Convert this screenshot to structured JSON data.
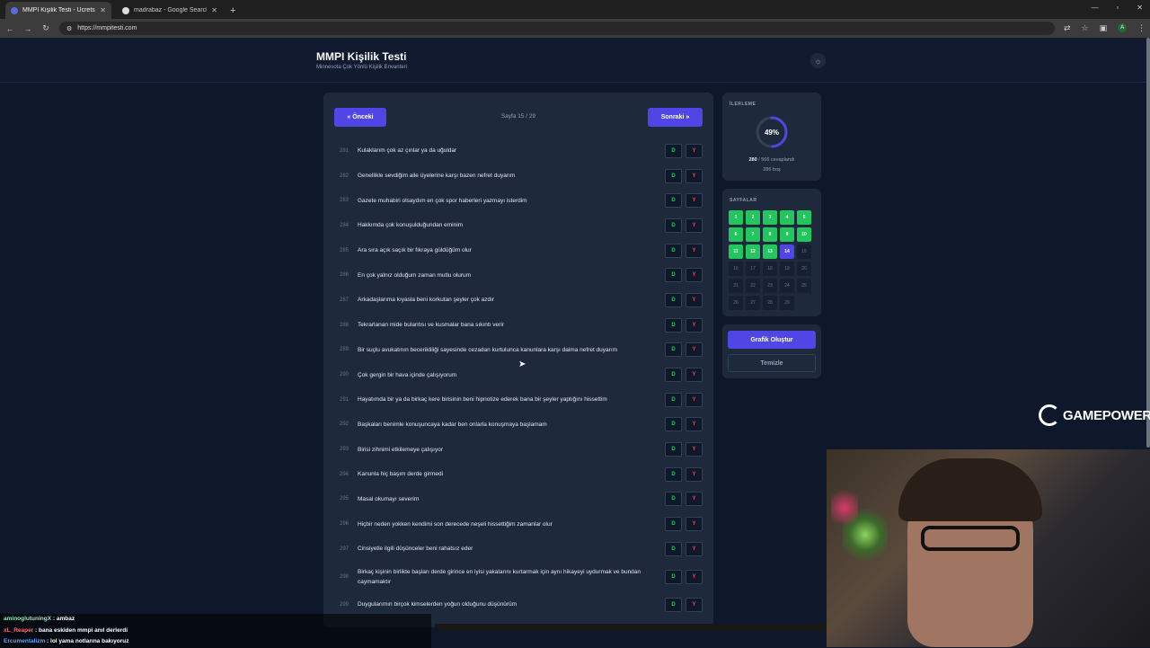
{
  "browser": {
    "tabs": [
      {
        "title": "MMPI Kişilik Testi - Ücretsiz Or"
      },
      {
        "title": "madrabaz - Google Search"
      }
    ],
    "url": "https://mmpitesti.com",
    "avatar_letter": "A"
  },
  "site": {
    "title": "MMPI Kişilik Testi",
    "subtitle": "Minnesota Çok Yönlü Kişilik Envanteri"
  },
  "pager": {
    "prev": "« Önceki",
    "next": "Sonraki »",
    "indicator": "Sayfa 15 / 29"
  },
  "answer_labels": {
    "d": "D",
    "y": "Y"
  },
  "questions": [
    {
      "num": "281",
      "text": "Kulaklarım çok az çınlar ya da uğuldar"
    },
    {
      "num": "282",
      "text": "Genellikle sevdiğim aile üyelerine karşı bazen nefret duyarım"
    },
    {
      "num": "283",
      "text": "Gazete muhabiri olsaydım en çok spor haberleri yazmayı isterdim"
    },
    {
      "num": "284",
      "text": "Hakkımda çok konuşulduğundan eminim"
    },
    {
      "num": "285",
      "text": "Ara sıra açık saçık bir fıkraya güldüğüm olur"
    },
    {
      "num": "286",
      "text": "En çok yalnız olduğum zaman mutlu olurum"
    },
    {
      "num": "287",
      "text": "Arkadaşlarıma kıyasla beni korkutan şeyler çok azdır"
    },
    {
      "num": "288",
      "text": "Tekrarlanan mide bulantısı ve kusmalar bana sıkıntı verir"
    },
    {
      "num": "289",
      "text": "Bir suçlu avukatının becerikliliği sayesinde cezadan kurtulunca kanunlara karşı daima nefret duyarım"
    },
    {
      "num": "290",
      "text": "Çok gergin bir hava içinde çalışıyorum"
    },
    {
      "num": "291",
      "text": "Hayatımda bir ya da birkaç kere birisinin beni hipnotize ederek bana bir şeyler yaptığını hissettim"
    },
    {
      "num": "292",
      "text": "Başkaları benimle konuşuncaya kadar ben onlarla konuşmaya başlamam"
    },
    {
      "num": "293",
      "text": "Birisi zihnimi etkilemeye çalışıyor"
    },
    {
      "num": "294",
      "text": "Kanunla hiç başım derde girmedi"
    },
    {
      "num": "295",
      "text": "Masal okumayı severim"
    },
    {
      "num": "296",
      "text": "Hiçbir neden yokken kendimi son derecede neşeli hissettiğim zamanlar olur"
    },
    {
      "num": "297",
      "text": "Cinsiyetle ilgili düşünceler beni rahatsız eder"
    },
    {
      "num": "298",
      "text": "Birkaç kişinin birlikte başları derde girince en iyisi yakalarını kurtarmak için aynı hikayeyi uydurmak ve bundan caymamaktır"
    },
    {
      "num": "299",
      "text": "Duygularımın birçok kimselerden yoğun olduğunu düşünürüm"
    }
  ],
  "progress": {
    "label": "İLERLEME",
    "percent_text": "49%",
    "percent": 49,
    "answered": "280",
    "answered_suffix": " / 566 cevaplandı",
    "empty": "286 boş"
  },
  "pages": {
    "label": "SAYFALAR",
    "items": [
      {
        "n": "1",
        "state": "done"
      },
      {
        "n": "2",
        "state": "done"
      },
      {
        "n": "3",
        "state": "done"
      },
      {
        "n": "4",
        "state": "done"
      },
      {
        "n": "5",
        "state": "done"
      },
      {
        "n": "6",
        "state": "done"
      },
      {
        "n": "7",
        "state": "done"
      },
      {
        "n": "8",
        "state": "done"
      },
      {
        "n": "9",
        "state": "done"
      },
      {
        "n": "10",
        "state": "done"
      },
      {
        "n": "11",
        "state": "done"
      },
      {
        "n": "12",
        "state": "done"
      },
      {
        "n": "13",
        "state": "done"
      },
      {
        "n": "14",
        "state": "current"
      },
      {
        "n": "15",
        "state": "empty"
      },
      {
        "n": "16",
        "state": "empty"
      },
      {
        "n": "17",
        "state": "empty"
      },
      {
        "n": "18",
        "state": "empty"
      },
      {
        "n": "19",
        "state": "empty"
      },
      {
        "n": "20",
        "state": "empty"
      },
      {
        "n": "21",
        "state": "empty"
      },
      {
        "n": "22",
        "state": "empty"
      },
      {
        "n": "23",
        "state": "empty"
      },
      {
        "n": "24",
        "state": "empty"
      },
      {
        "n": "25",
        "state": "empty"
      },
      {
        "n": "26",
        "state": "empty"
      },
      {
        "n": "27",
        "state": "empty"
      },
      {
        "n": "28",
        "state": "empty"
      },
      {
        "n": "29",
        "state": "empty"
      }
    ]
  },
  "actions": {
    "chart": "Grafik Oluştur",
    "clear": "Temizle"
  },
  "overlay": {
    "logo": "GAMEPOWER"
  },
  "chat": [
    {
      "user": "aminoglutuningX",
      "msg": " : ambaz",
      "color": "g"
    },
    {
      "user": "xL_Reaper",
      "msg": " : bana eskiden mmpi anıl derlerdi",
      "color": "r"
    },
    {
      "user": "Ercumentalizm",
      "msg": " : lol yama notlarına bakıyoruz",
      "color": "b"
    }
  ]
}
